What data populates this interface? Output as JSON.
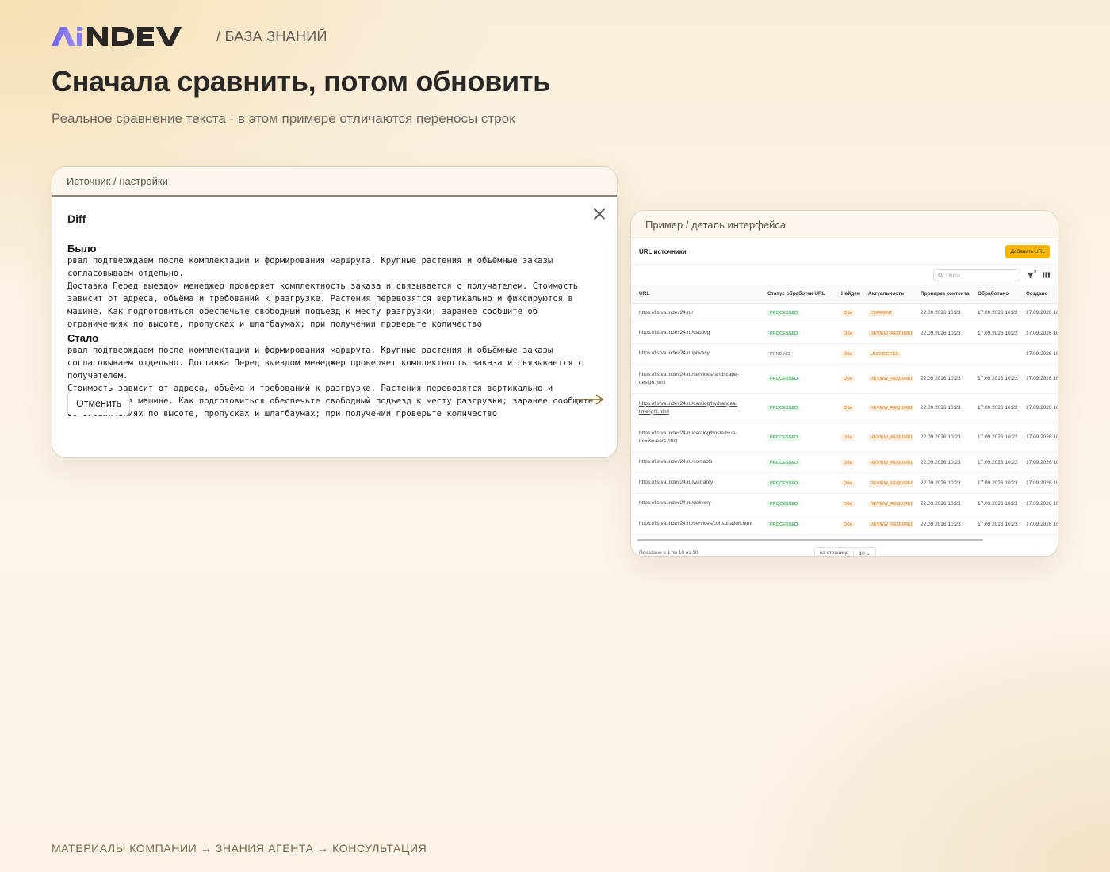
{
  "header": {
    "brand": "AiNDEV",
    "section": "/ БАЗА ЗНАНИЙ"
  },
  "title": "Сначала сравнить, потом обновить",
  "subtitle": "Реальное сравнение текста · в этом примере отличаются переносы строк",
  "left_card": {
    "caption": "Источник / настройки",
    "dialog_title": "Diff",
    "before_label": "Было",
    "before_text": "рвал подтверждаем после комплектации и формирования маршрута. Крупные растения и объёмные заказы согласовываем отдельно.\nДоставка Перед выездом менеджер проверяет комплектность заказа и связывается с получателем. Стоимость зависит от адреса, объёма и требований к разгрузке. Растения перевозятся вертикально и фиксируются в машине. Как подготовиться обеспечьте свободный подъезд к месту разгрузки; заранее сообщите об ограничениях по высоте, пропусках и шлагбаумах; при получении проверьте количество",
    "after_label": "Стало",
    "after_text": "рвал подтверждаем после комплектации и формирования маршрута. Крупные растения и объёмные заказы согласовываем отдельно. Доставка Перед выездом менеджер проверяет комплектность заказа и связывается с получателем.\nСтоимость зависит от адреса, объёма и требований к разгрузке. Растения перевозятся вертикально и фиксируются в машине. Как подготовиться обеспечьте свободный подъезд к месту разгрузки; заранее сообщите об ограничениях по высоте, пропусках и шлагбаумах; при получении проверьте количество",
    "cancel_label": "Отменить"
  },
  "right_card": {
    "caption": "Пример / деталь интерфейса",
    "panel_title": "URL источники",
    "add_button": "Добавить URL",
    "search_placeholder": "Поиск",
    "filter_count": "0",
    "columns": [
      "URL",
      "Статус обработки URL",
      "Найден",
      "Актуальность",
      "Проверка контента",
      "Обработано",
      "Создано"
    ],
    "rows": [
      {
        "url": "https://listva.indev24.ru/",
        "status": "PROCESSED",
        "found": "Оба",
        "actuality": "CURRENT",
        "checked": "22.09.2026 10:23",
        "processed": "17.09.2026 10:22",
        "created": "17.09.2026 10"
      },
      {
        "url": "https://listva.indev24.ru/catalog",
        "status": "PROCESSED",
        "found": "Оба",
        "actuality": "REVIEW_REQUIRED",
        "checked": "22.09.2026 10:23",
        "processed": "17.09.2026 10:22",
        "created": "17.09.2026 10"
      },
      {
        "url": "https://listva.indev24.ru/privacy",
        "status": "PENDING",
        "found": "Оба",
        "actuality": "UNCHECKED",
        "checked": "",
        "processed": "",
        "created": "17.09.2026 10"
      },
      {
        "url": "https://listva.indev24.ru/services/landscape-design.html",
        "status": "PROCESSED",
        "found": "Оба",
        "actuality": "REVIEW_REQUIRED",
        "checked": "22.09.2026 10:23",
        "processed": "17.09.2026 10:22",
        "created": "17.09.2026 10"
      },
      {
        "url": "https://listva.indev24.ru/catalog/hydrangea-limelight.html",
        "status": "PROCESSED",
        "found": "Оба",
        "actuality": "REVIEW_REQUIRED",
        "checked": "22.09.2026 10:23",
        "processed": "17.09.2026 10:22",
        "created": "17.09.2026 10"
      },
      {
        "url": "https://listva.indev24.ru/catalog/hosta-blue-mouse-ears.html",
        "status": "PROCESSED",
        "found": "Оба",
        "actuality": "REVIEW_REQUIRED",
        "checked": "22.09.2026 10:23",
        "processed": "17.09.2026 10:22",
        "created": "17.09.2026 10"
      },
      {
        "url": "https://listva.indev24.ru/contacts",
        "status": "PROCESSED",
        "found": "Оба",
        "actuality": "REVIEW_REQUIRED",
        "checked": "22.09.2026 10:23",
        "processed": "17.09.2026 10:22",
        "created": "17.09.2026 10"
      },
      {
        "url": "https://listva.indev24.ru/warranty",
        "status": "PROCESSED",
        "found": "Оба",
        "actuality": "REVIEW_REQUIRED",
        "checked": "22.09.2026 10:23",
        "processed": "17.09.2026 10:23",
        "created": "17.09.2026 10"
      },
      {
        "url": "https://listva.indev24.ru/delivery",
        "status": "PROCESSED",
        "found": "Оба",
        "actuality": "REVIEW_REQUIRED",
        "checked": "22.09.2026 10:23",
        "processed": "17.09.2026 10:23",
        "created": "17.09.2026 10"
      },
      {
        "url": "https://listva.indev24.ru/services/consultation.html",
        "status": "PROCESSED",
        "found": "Оба",
        "actuality": "REVIEW_REQUIRED",
        "checked": "22.09.2026 10:23",
        "processed": "17.09.2026 10:23",
        "created": "17.09.2026 10"
      }
    ],
    "footer_shown": "Показано с 1 по 10 из 10",
    "per_page_label": "на странице",
    "per_page_value": "10"
  },
  "footer": "МАТЕРИАЛЫ КОМПАНИИ → ЗНАНИЯ АГЕНТА → КОНСУЛЬТАЦИЯ",
  "colors": {
    "accent_gold": "#f7b500",
    "logo_purple": "#7b6cf0",
    "logo_dark": "#2a2826",
    "status_green": "#2e9b4c",
    "status_orange": "#d57a1a"
  },
  "icons": [
    "close-icon",
    "arrow-right-icon",
    "search-icon",
    "filter-icon",
    "columns-icon",
    "chevron-down-icon"
  ]
}
